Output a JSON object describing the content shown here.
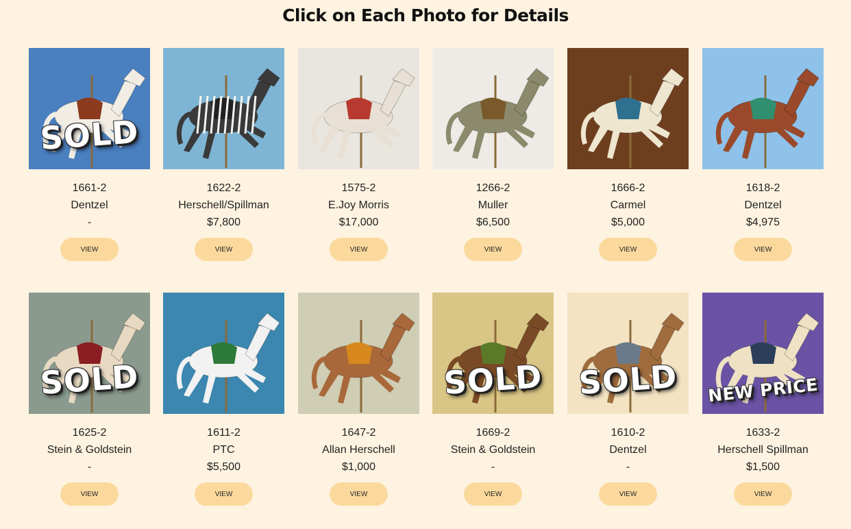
{
  "header": {
    "title": "Click on Each Photo for Details"
  },
  "button_label": "VIEW",
  "items": [
    {
      "sku": "1661-2",
      "maker": "Dentzel",
      "price": "-",
      "badge": "SOLD",
      "bg": "#4a7fc0"
    },
    {
      "sku": "1622-2",
      "maker": "Herschell/Spillman",
      "price": "$7,800",
      "badge": "",
      "bg": "#7fb5d4"
    },
    {
      "sku": "1575-2",
      "maker": "E.Joy Morris",
      "price": "$17,000",
      "badge": "",
      "bg": "#e9e6e0"
    },
    {
      "sku": "1266-2",
      "maker": "Muller",
      "price": "$6,500",
      "badge": "",
      "bg": "#eeebe6"
    },
    {
      "sku": "1666-2",
      "maker": "Carmel",
      "price": "$5,000",
      "badge": "",
      "bg": "#6e3f1f"
    },
    {
      "sku": "1618-2",
      "maker": "Dentzel",
      "price": "$4,975",
      "badge": "",
      "bg": "#8fc2ea"
    },
    {
      "sku": "1625-2",
      "maker": "Stein & Goldstein",
      "price": "-",
      "badge": "SOLD",
      "bg": "#8a9a8e"
    },
    {
      "sku": "1611-2",
      "maker": "PTC",
      "price": "$5,500",
      "badge": "",
      "bg": "#3b87b0"
    },
    {
      "sku": "1647-2",
      "maker": "Allan Herschell",
      "price": "$1,000",
      "badge": "",
      "bg": "#cfcdb4"
    },
    {
      "sku": "1669-2",
      "maker": "Stein & Goldstein",
      "price": "-",
      "badge": "SOLD",
      "bg": "#d9c585"
    },
    {
      "sku": "1610-2",
      "maker": "Dentzel",
      "price": "-",
      "badge": "SOLD",
      "bg": "#f3e3c3"
    },
    {
      "sku": "1633-2",
      "maker": "Herschell Spillman",
      "price": "$1,500",
      "badge": "NEW PRICE",
      "bg": "#6a53a4"
    }
  ]
}
